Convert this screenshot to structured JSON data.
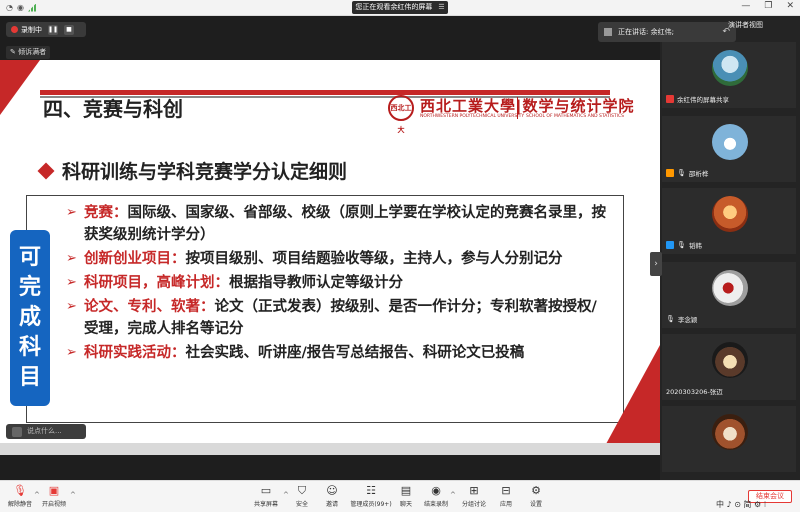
{
  "titlebar": {
    "sharing_notice": "您正在观看余红伟的屏幕",
    "menu_glyph": "☰",
    "window_controls": [
      "—",
      "❐",
      "✕"
    ]
  },
  "recording": {
    "label": "录制中",
    "pause_glyph": "❚❚",
    "stop_glyph": "■"
  },
  "prompt_pill": {
    "label": "倾诉满者"
  },
  "speaking": {
    "label": "正在讲话: 余红伟;"
  },
  "view_mode": {
    "label": "演讲者视图"
  },
  "slide": {
    "section_title": "四、竞赛与科创",
    "logo": {
      "seal_text": "西北工大",
      "name_cn": "西北工業大學|数学与统计学院",
      "name_en_univ": "NORTHWESTERN POLYTECHNICAL UNIVERSITY",
      "name_en_school": "SCHOOL OF MATHEMATICS AND STATISTICS"
    },
    "heading": "科研训练与学科竞赛学分认定细则",
    "side_tag": [
      "可",
      "完",
      "成",
      "科",
      "目"
    ],
    "arrow_glyph": "➢",
    "items": [
      {
        "key": "竞赛：",
        "text": "国际级、国家级、省部级、校级（原则上学要在学校认定的竞赛名录里，按获奖级别统计学分）"
      },
      {
        "key": "创新创业项目：",
        "text": "按项目级别、项目结题验收等级，主持人，参与人分别记分"
      },
      {
        "key": "科研项目，高峰计划：",
        "text": "根据指导教师认定等级计分"
      },
      {
        "key": "论文、专利、软著：",
        "text": "论文（正式发表）按级别、是否一作计分；专利软著按授权/受理，完成人排名等记分"
      },
      {
        "key": "科研实践活动：",
        "text": "社会实践、听讲座/报告写总结报告、科研论文已投稿"
      }
    ]
  },
  "chat_pill": {
    "placeholder": "说点什么..."
  },
  "participants": [
    {
      "name": "余红伟的屏幕共享",
      "icon_color": "#e53935",
      "avatar_color": "#4a8fb5"
    },
    {
      "name": "邵析桦",
      "icon_color": "#ff9800",
      "avatar_color": "#7fb3d9"
    },
    {
      "name": "韬韩",
      "icon_color": "#2196f3",
      "avatar_color": "#c75b2a"
    },
    {
      "name": "李念颖",
      "icon_color": "#9e9e9e",
      "avatar_color": "#d9d9d9"
    },
    {
      "name": "2020303206-张迈",
      "icon_color": "#9e9e9e",
      "avatar_color": "#5a3a2a"
    },
    {
      "name": "",
      "icon_color": "#9e9e9e",
      "avatar_color": "#a0522d"
    }
  ],
  "toolbar": {
    "mic": {
      "label": "解除静音",
      "icon": "microphone-icon"
    },
    "video": {
      "label": "开启视频",
      "icon": "camera-icon"
    },
    "share": {
      "label": "共享屏幕",
      "icon": "screen-share-icon"
    },
    "security": {
      "label": "安全",
      "icon": "shield-icon"
    },
    "invite": {
      "label": "邀请",
      "icon": "invite-icon"
    },
    "members": {
      "label": "管理成员(99+)",
      "icon": "people-icon"
    },
    "chat": {
      "label": "聊天",
      "icon": "chat-icon"
    },
    "record": {
      "label": "结束录制",
      "icon": "record-icon"
    },
    "breakout": {
      "label": "分组讨论",
      "icon": "grid-icon"
    },
    "apps": {
      "label": "应用",
      "icon": "apps-icon"
    },
    "settings": {
      "label": "设置",
      "icon": "gear-icon"
    },
    "end_meeting": {
      "label": "结束会议"
    }
  },
  "ime": {
    "text": "中 ♪ ⊙ 简 ⚙ ⁝"
  },
  "colors": {
    "accent_red": "#c62828",
    "tag_blue": "#1565c0"
  }
}
